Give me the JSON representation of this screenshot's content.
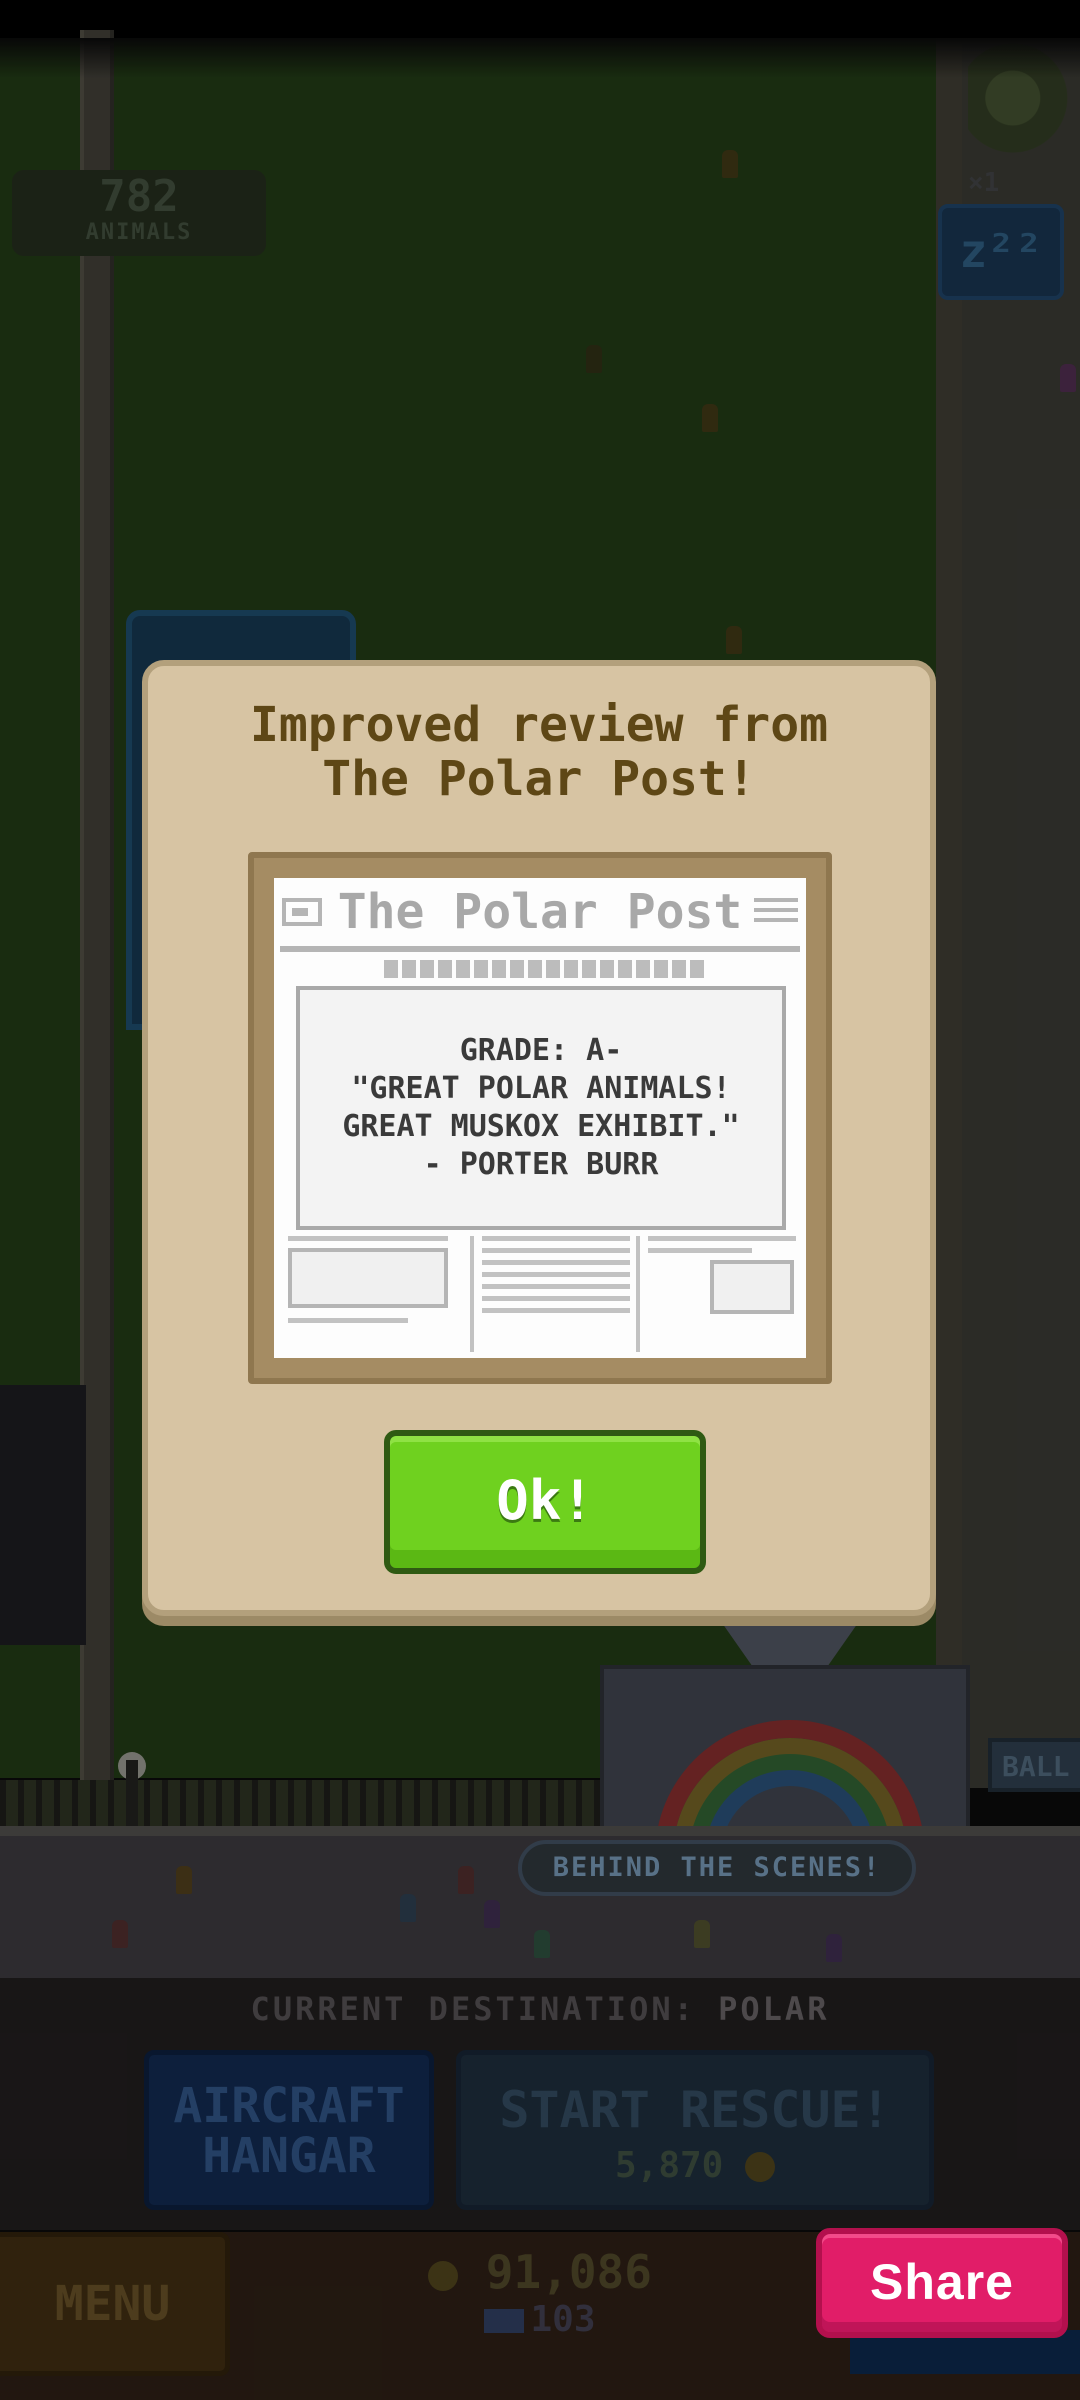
{
  "hud": {
    "animal_count": "782",
    "animal_label": "ANIMALS",
    "sleep_multiplier": "×1",
    "sleep_button": "z²²"
  },
  "scene": {
    "behind_the_scenes": "BEHIND THE SCENES!",
    "side_sign": "BALL"
  },
  "bottom": {
    "destination_prefix": "CURRENT DESTINATION:",
    "destination_value": "POLAR",
    "hangar_line1": "AIRCRAFT",
    "hangar_line2": "HANGAR",
    "rescue_label": "START RESCUE!",
    "rescue_cost": "5,870",
    "menu_label": "MENU",
    "coins": "91,086",
    "bills": "103",
    "share_label": "Share"
  },
  "modal": {
    "title_line1": "Improved review from",
    "title_line2": "The Polar Post!",
    "paper_name": "The Polar Post",
    "review_grade": "GRADE: A-",
    "review_quote1": "\"GREAT POLAR ANIMALS!",
    "review_quote2": "GREAT MUSKOX EXHIBIT.\"",
    "review_author": "- PORTER BURR",
    "ok_label": "Ok!"
  },
  "colors": {
    "modal_bg": "#d7c4a3",
    "ok_green": "#6fd11f",
    "share_pink": "#e11d68",
    "title_brown": "#5e4716"
  }
}
